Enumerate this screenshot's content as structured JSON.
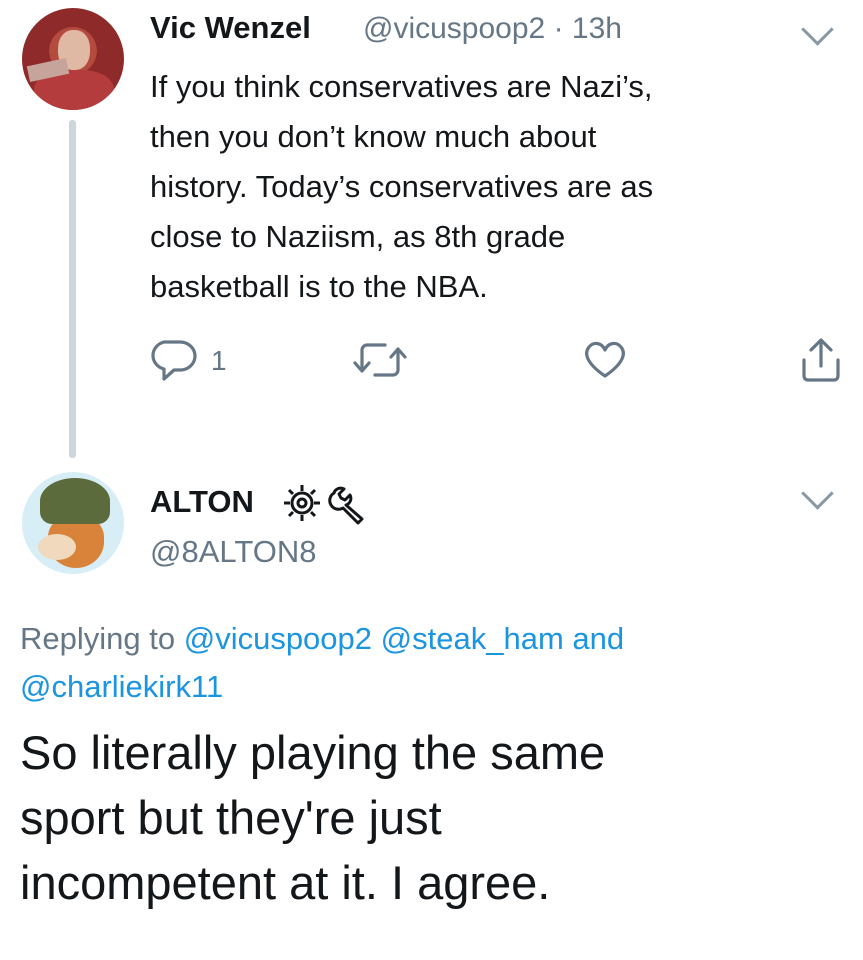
{
  "tweet1": {
    "display_name": "Vic Wenzel",
    "handle": "@vicuspoop2",
    "separator": "·",
    "time": "13h",
    "text_lines": [
      "If you think conservatives are Nazi’s,",
      "then you don’t know much about",
      "history. Today’s conservatives are as",
      "close to Naziism, as 8th grade",
      "basketball is to the NBA."
    ],
    "reply_count": "1",
    "icons": [
      "reply-icon",
      "retweet-icon",
      "like-icon",
      "share-icon",
      "chevron-down-icon"
    ]
  },
  "tweet2": {
    "display_name": "ALTON",
    "handle": "@8ALTON8",
    "name_icons": [
      "gear-icon",
      "wrench-icon"
    ],
    "replying_prefix": "Replying to",
    "replying_users": [
      "@vicuspoop2",
      "@steak_ham"
    ],
    "replying_and": "and",
    "replying_last": "@charliekirk11",
    "text_lines": [
      "So literally playing the same",
      "sport but they're just",
      "incompetent at it. I agree."
    ]
  },
  "colors": {
    "text": "#14171a",
    "secondary": "#657786",
    "link": "#1b95e0",
    "thread_line": "#ccd6dd"
  }
}
